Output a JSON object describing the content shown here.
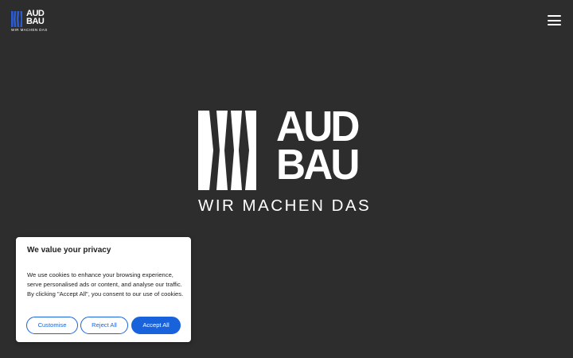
{
  "header": {
    "logo_word_line1": "AUD",
    "logo_word_line2": "BAU",
    "logo_tagline": "WIR MACHEN DAS",
    "menu_icon": "hamburger-icon"
  },
  "hero": {
    "logo_word_line1": "AUD",
    "logo_word_line2": "BAU",
    "logo_tagline": "WIR MACHEN DAS"
  },
  "cookie_banner": {
    "title": "We value your privacy",
    "text_line1": "We use cookies to enhance your browsing experience,",
    "text_line2": "serve personalised ads or content, and analyse our traffic.",
    "text_line3": "By clicking \"Accept All\", you consent to our use of cookies.",
    "customise_label": "Customise",
    "reject_label": "Reject All",
    "accept_label": "Accept All"
  },
  "colors": {
    "background": "#2d2d2d",
    "logo_blue": "#2a5bd7",
    "accent": "#1863dc",
    "white": "#ffffff"
  }
}
